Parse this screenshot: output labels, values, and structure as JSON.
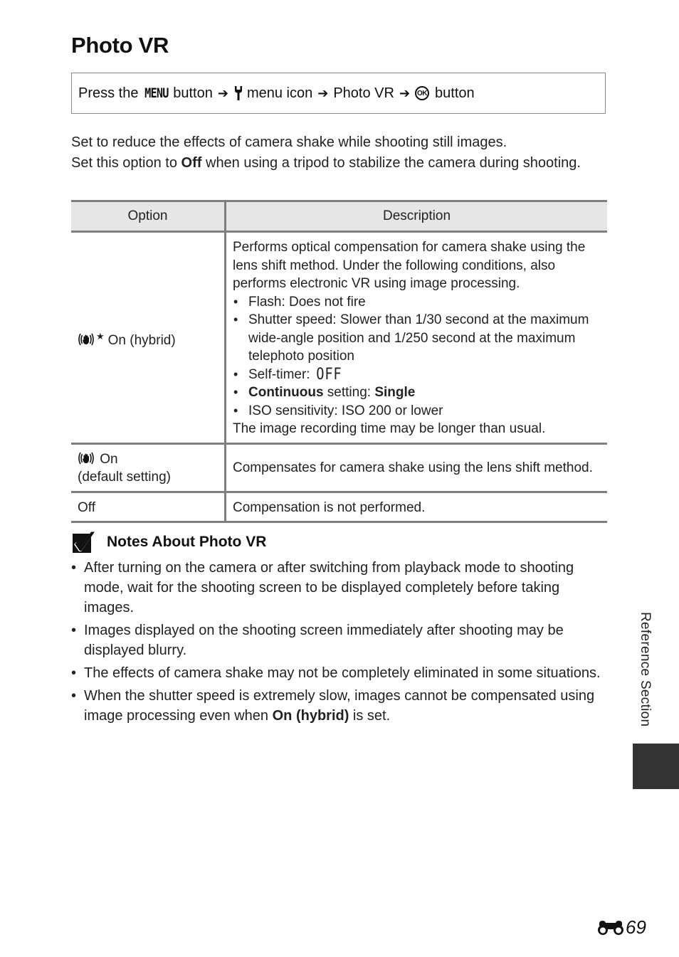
{
  "page": {
    "title": "Photo VR",
    "nav_path": {
      "press_the": "Press the",
      "menu_glyph": "MENU",
      "button_word": "button",
      "menu_icon_label": "menu icon",
      "item": "Photo VR",
      "ok_glyph": "OK",
      "ok_button_word": "button",
      "arrow": "➔",
      "icons": [
        "menu-button-icon",
        "wrench-setup-icon",
        "ok-button-icon",
        "arrow-icon"
      ]
    },
    "intro": {
      "line1": "Set to reduce the effects of camera shake while shooting still images.",
      "line2_pre": "Set this option to ",
      "line2_bold": "Off",
      "line2_post": " when using a tripod to stabilize the camera during shooting."
    },
    "table": {
      "headers": [
        "Option",
        "Description"
      ],
      "rows": [
        {
          "option": "On (hybrid)",
          "option_icon": "vr-hybrid-icon",
          "desc_intro": "Performs optical compensation for camera shake using the lens shift method. Under the following conditions, also performs electronic VR using image processing.",
          "bullets": [
            {
              "text": "Flash: Does not fire"
            },
            {
              "text": "Shutter speed: Slower than 1/30 second at the maximum wide-angle position and 1/250 second at the maximum telephoto position"
            },
            {
              "pre": "Self-timer: ",
              "glyph": "OFF"
            },
            {
              "bold1": "Continuous",
              "mid": " setting: ",
              "bold2": "Single"
            },
            {
              "text": "ISO sensitivity: ISO 200 or lower"
            }
          ],
          "desc_outro": "The image recording time may be longer than usual."
        },
        {
          "option": "On",
          "option_line2": "(default setting)",
          "option_icon": "vr-on-icon",
          "desc": "Compensates for camera shake using the lens shift method."
        },
        {
          "option": "Off",
          "desc": "Compensation is not performed."
        }
      ]
    },
    "notes": {
      "heading": "Notes About Photo VR",
      "items": [
        {
          "text": "After turning on the camera or after switching from playback mode to shooting mode, wait for the shooting screen to be displayed completely before taking images."
        },
        {
          "text": "Images displayed on the shooting screen immediately after shooting may be displayed blurry."
        },
        {
          "text": "The effects of camera shake may not be completely eliminated in some situations."
        },
        {
          "pre": "When the shutter speed is extremely slow, images cannot be compensated using image processing even when ",
          "bold": "On (hybrid)",
          "post": " is set."
        }
      ]
    },
    "side_label": "Reference Section",
    "page_number": "69",
    "colors": {
      "table_header_bg": "#e6e6e6",
      "rule": "#7f7f7f",
      "side_tab": "#333333"
    }
  }
}
